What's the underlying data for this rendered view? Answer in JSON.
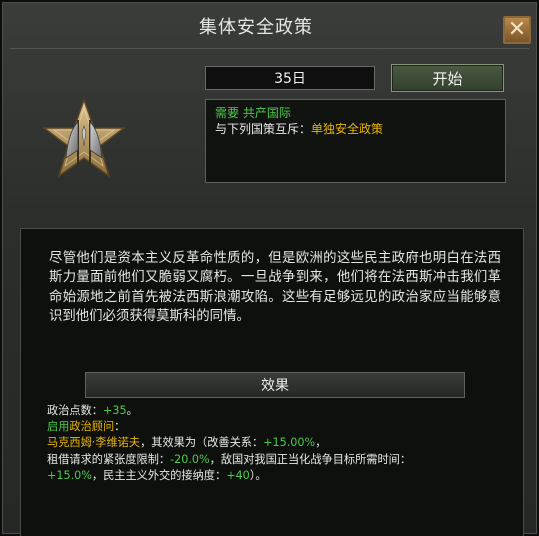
{
  "window": {
    "title": "集体安全政策",
    "close_glyph": "✕"
  },
  "focus": {
    "days": "35日",
    "start_label": "开始",
    "icon": "star-emblem-with-flags-icon"
  },
  "requirements": {
    "requires_label": "需要",
    "requires_value": "共产国际",
    "exclusive_label": "与下列国策互斥：",
    "exclusive_value": "单独安全政策"
  },
  "description": "尽管他们是资本主义反革命性质的，但是欧洲的这些民主政府也明白在法西斯力量面前他们又脆弱又腐朽。一旦战争到来，他们将在法西斯冲击我们革命始源地之前首先被法西斯浪潮攻陷。这些有足够远见的政治家应当能够意识到他们必须获得莫斯科的同情。",
  "effects": {
    "header": "效果",
    "pp_label": "政治点数：",
    "pp_value": "+35",
    "pp_end": "。",
    "enable_label": "启用",
    "advisor_label": "政治顾问",
    "advisor_colon": "：",
    "advisor_name": "马克西姆·李维诺夫",
    "effect_intro": "，其效果为（改善关系：",
    "improve_value": "+15.00%",
    "comma1": "，",
    "guarantee_label": "租借请求的紧张度限制：",
    "guarantee_value": "-20.0%",
    "justify_text": "，敌国对我国正当化战争目标所需时间：",
    "justify_value": "+15.0%",
    "democracy_text": "，民主主义外交的接纳度：",
    "democracy_value": "+40",
    "end": "）。"
  },
  "colors": {
    "positive": "#4ec94e",
    "highlight": "#e6b400",
    "text": "#e8e8e8"
  }
}
